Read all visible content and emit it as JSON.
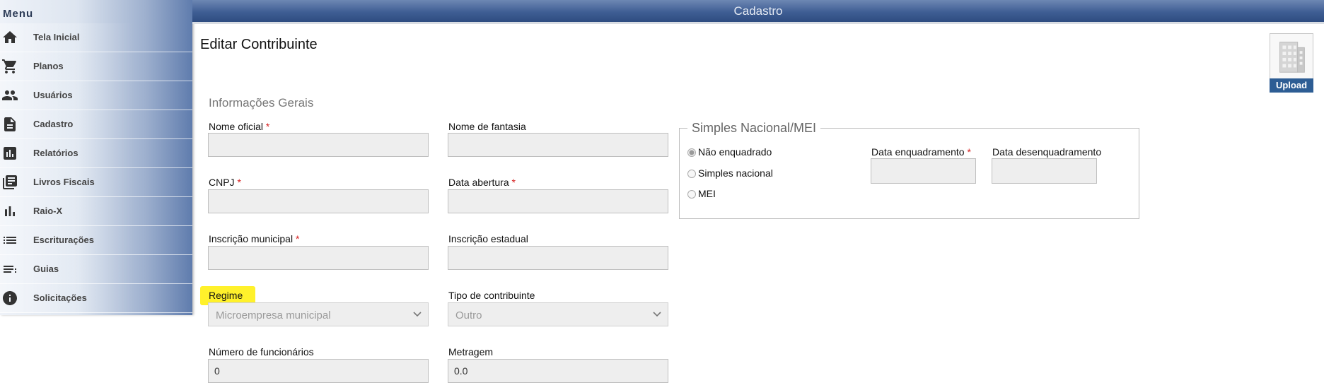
{
  "sidebar": {
    "title": "Menu",
    "items": [
      {
        "label": "Tela Inicial",
        "icon": "home-icon"
      },
      {
        "label": "Planos",
        "icon": "cart-icon"
      },
      {
        "label": "Usuários",
        "icon": "users-icon"
      },
      {
        "label": "Cadastro",
        "icon": "document-icon"
      },
      {
        "label": "Relatórios",
        "icon": "report-icon"
      },
      {
        "label": "Livros Fiscais",
        "icon": "books-icon"
      },
      {
        "label": "Raio-X",
        "icon": "bar-chart-icon"
      },
      {
        "label": "Escriturações",
        "icon": "list-icon"
      },
      {
        "label": "Guias",
        "icon": "guides-icon"
      },
      {
        "label": "Solicitações",
        "icon": "info-icon"
      }
    ]
  },
  "header": {
    "title": "Cadastro"
  },
  "page": {
    "title": "Editar Contribuinte"
  },
  "form": {
    "section_title": "Informações Gerais",
    "required_mark": "*",
    "nome_oficial": {
      "label": "Nome oficial",
      "value": ""
    },
    "nome_fantasia": {
      "label": "Nome de fantasia",
      "value": ""
    },
    "cnpj": {
      "label": "CNPJ",
      "value": ""
    },
    "data_abertura": {
      "label": "Data abertura",
      "value": ""
    },
    "inscricao_municipal": {
      "label": "Inscrição municipal",
      "value": ""
    },
    "inscricao_estadual": {
      "label": "Inscrição estadual",
      "value": ""
    },
    "regime": {
      "label": "Regime",
      "value": "Microempresa municipal"
    },
    "tipo_contribuinte": {
      "label": "Tipo de contribuinte",
      "value": "Outro"
    },
    "numero_funcionarios": {
      "label": "Número de funcionários",
      "value": "0"
    },
    "metragem": {
      "label": "Metragem",
      "value": "0.0"
    }
  },
  "simples": {
    "legend": "Simples Nacional/MEI",
    "options": [
      "Não enquadrado",
      "Simples nacional",
      "MEI"
    ],
    "selected": "Não enquadrado",
    "data_enquadramento": {
      "label": "Data enquadramento",
      "value": ""
    },
    "data_desenquadramento": {
      "label": "Data desenquadramento",
      "value": ""
    }
  },
  "upload": {
    "label": "Upload",
    "icon": "building-icon"
  },
  "colors": {
    "header": "#3f5e94",
    "highlight": "#fff12b",
    "required": "#d62020",
    "upload_button": "#2d5d94"
  }
}
